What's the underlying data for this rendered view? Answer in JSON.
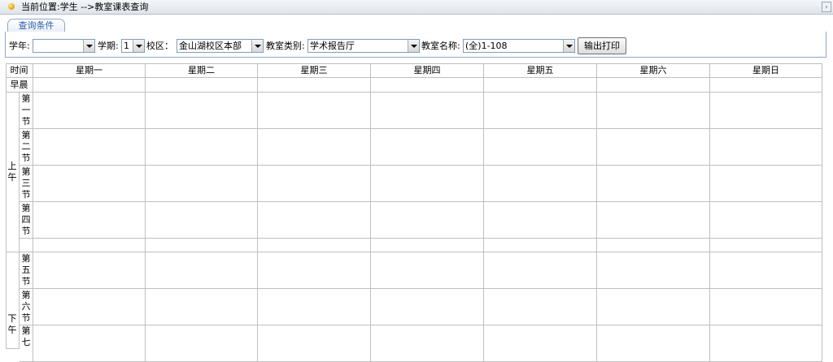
{
  "breadcrumb": {
    "text": "当前位置:学生 -->教室课表查询"
  },
  "query": {
    "tab_label": "查询条件",
    "year_label": "学年:",
    "year_value": "",
    "term_label": "学期:",
    "term_value": "1",
    "campus_label": "校区：",
    "campus_value": "金山湖校区本部",
    "room_type_label": "教室类别:",
    "room_type_value": "学术报告厅",
    "room_name_label": "教室名称:",
    "room_name_value": "(全)1-108",
    "print_button": "输出打印"
  },
  "schedule": {
    "time_header": "时间",
    "days": [
      "星期一",
      "星期二",
      "星期三",
      "星期四",
      "星期五",
      "星期六",
      "星期日"
    ],
    "early_morning": "早晨",
    "morning": "上午",
    "afternoon": "下午",
    "periods": [
      "第一节",
      "第二节",
      "第三节",
      "第四节",
      "第五节",
      "第六节",
      "第七"
    ]
  }
}
